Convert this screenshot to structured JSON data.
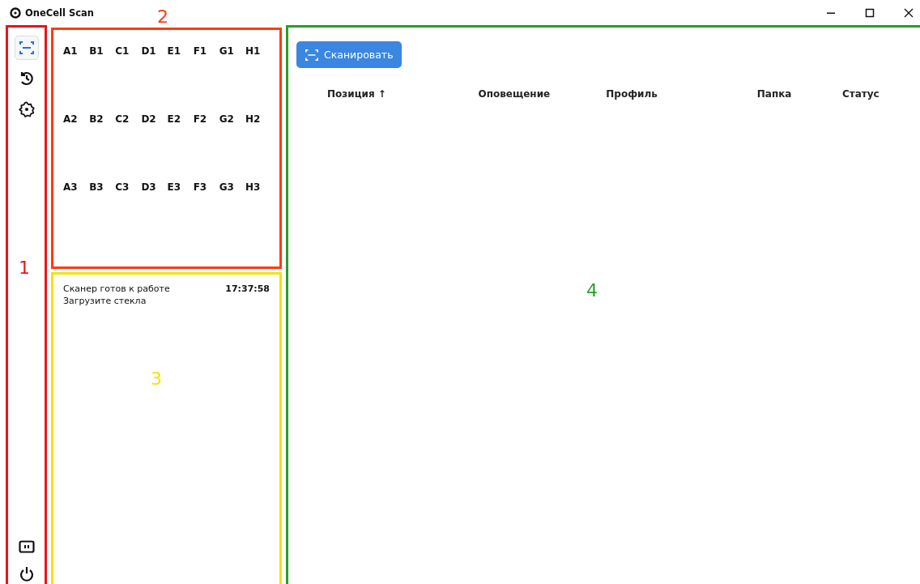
{
  "window": {
    "title": "OneCell Scan"
  },
  "annotations": [
    {
      "label": "1",
      "color": "#e8141a"
    },
    {
      "label": "2",
      "color": "#ff3b0f"
    },
    {
      "label": "3",
      "color": "#f2e20a"
    },
    {
      "label": "4",
      "color": "#2a9d2a"
    }
  ],
  "sidebar": {
    "items": [
      {
        "kind": "scan",
        "selected": true
      },
      {
        "kind": "history",
        "selected": false
      },
      {
        "kind": "settings",
        "selected": false
      }
    ],
    "bottom": [
      {
        "kind": "panel"
      },
      {
        "kind": "power"
      }
    ]
  },
  "plate": {
    "rows": [
      [
        "A1",
        "B1",
        "C1",
        "D1",
        "E1",
        "F1",
        "G1",
        "H1"
      ],
      [
        "A2",
        "B2",
        "C2",
        "D2",
        "E2",
        "F2",
        "G2",
        "H2"
      ],
      [
        "A3",
        "B3",
        "C3",
        "D3",
        "E3",
        "F3",
        "G3",
        "H3"
      ]
    ]
  },
  "log": [
    {
      "lines": [
        "Сканер готов к работе",
        "Загрузите стекла"
      ],
      "time": "17:37:58"
    }
  ],
  "scan_button": "Сканировать",
  "table": {
    "columns": [
      {
        "label": "Позиция",
        "sort": "↑"
      },
      {
        "label": "Оповещение"
      },
      {
        "label": "Профиль"
      },
      {
        "label": "Папка"
      },
      {
        "label": "Статус"
      }
    ]
  }
}
